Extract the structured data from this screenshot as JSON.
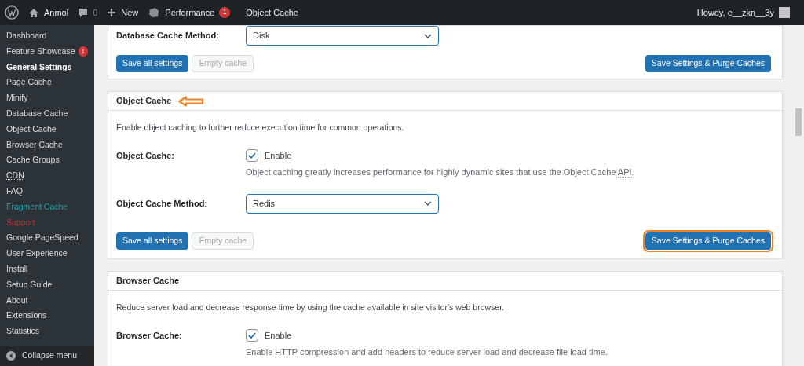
{
  "admin_bar": {
    "site": "Anmol",
    "comments": "0",
    "new": "New",
    "performance": "Performance",
    "performance_badge": "1",
    "current": "Object Cache",
    "howdy": "Howdy, e__zkn__3y"
  },
  "sidebar": {
    "items": [
      {
        "label": "Dashboard",
        "kind": "normal",
        "selected": false
      },
      {
        "label": "Feature Showcase",
        "kind": "normal",
        "selected": false,
        "badge": "1"
      },
      {
        "label": "General Settings",
        "kind": "normal",
        "selected": true
      },
      {
        "label": "Page Cache",
        "kind": "normal",
        "selected": false
      },
      {
        "label": "Minify",
        "kind": "normal",
        "selected": false
      },
      {
        "label": "Database Cache",
        "kind": "normal",
        "selected": false
      },
      {
        "label": "Object Cache",
        "kind": "normal",
        "selected": false
      },
      {
        "label": "Browser Cache",
        "kind": "normal",
        "selected": false
      },
      {
        "label": "Cache Groups",
        "kind": "normal",
        "selected": false
      },
      {
        "label": "CDN",
        "kind": "abbr",
        "selected": false
      },
      {
        "label": "FAQ",
        "kind": "normal",
        "selected": false
      },
      {
        "label": "Fragment Cache",
        "kind": "teal",
        "selected": false
      },
      {
        "label": "Support",
        "kind": "red",
        "selected": false
      },
      {
        "label": "Google PageSpeed",
        "kind": "normal",
        "selected": false
      },
      {
        "label": "User Experience",
        "kind": "normal",
        "selected": false
      },
      {
        "label": "Install",
        "kind": "normal",
        "selected": false
      },
      {
        "label": "Setup Guide",
        "kind": "normal",
        "selected": false
      },
      {
        "label": "About",
        "kind": "normal",
        "selected": false
      },
      {
        "label": "Extensions",
        "kind": "normal",
        "selected": false
      },
      {
        "label": "Statistics",
        "kind": "normal",
        "selected": false
      }
    ],
    "collapse": "Collapse menu"
  },
  "panels": [
    {
      "rows": [
        {
          "kind": "select",
          "label": "Database Cache Method:",
          "value": "Disk"
        }
      ],
      "buttons": {
        "save": "Save all settings",
        "empty": "Empty cache",
        "purge": "Save Settings & Purge Caches",
        "purge_highlighted": false
      }
    },
    {
      "title": "Object Cache",
      "arrow": true,
      "description": "Enable object caching to further reduce execution time for common operations.",
      "rows": [
        {
          "kind": "checkbox",
          "label": "Object Cache:",
          "option": "Enable",
          "checked": true,
          "help": [
            {
              "kind": "plain",
              "text": "Object caching greatly increases performance for highly dynamic sites that use the Object Cache "
            },
            {
              "kind": "abbr",
              "text": "API"
            },
            {
              "kind": "plain",
              "text": "."
            }
          ]
        },
        {
          "kind": "select",
          "label": "Object Cache Method:",
          "value": "Redis"
        }
      ],
      "buttons": {
        "save": "Save all settings",
        "empty": "Empty cache",
        "purge": "Save Settings & Purge Caches",
        "purge_highlighted": true
      }
    },
    {
      "title": "Browser Cache",
      "description": "Reduce server load and decrease response time by using the cache available in site visitor's web browser.",
      "rows": [
        {
          "kind": "checkbox",
          "label": "Browser Cache:",
          "option": "Enable",
          "checked": true,
          "help": [
            {
              "kind": "plain",
              "text": "Enable "
            },
            {
              "kind": "abbr",
              "text": "HTTP"
            },
            {
              "kind": "plain",
              "text": " compression and add headers to reduce server load and decrease file load time."
            }
          ]
        }
      ]
    }
  ]
}
